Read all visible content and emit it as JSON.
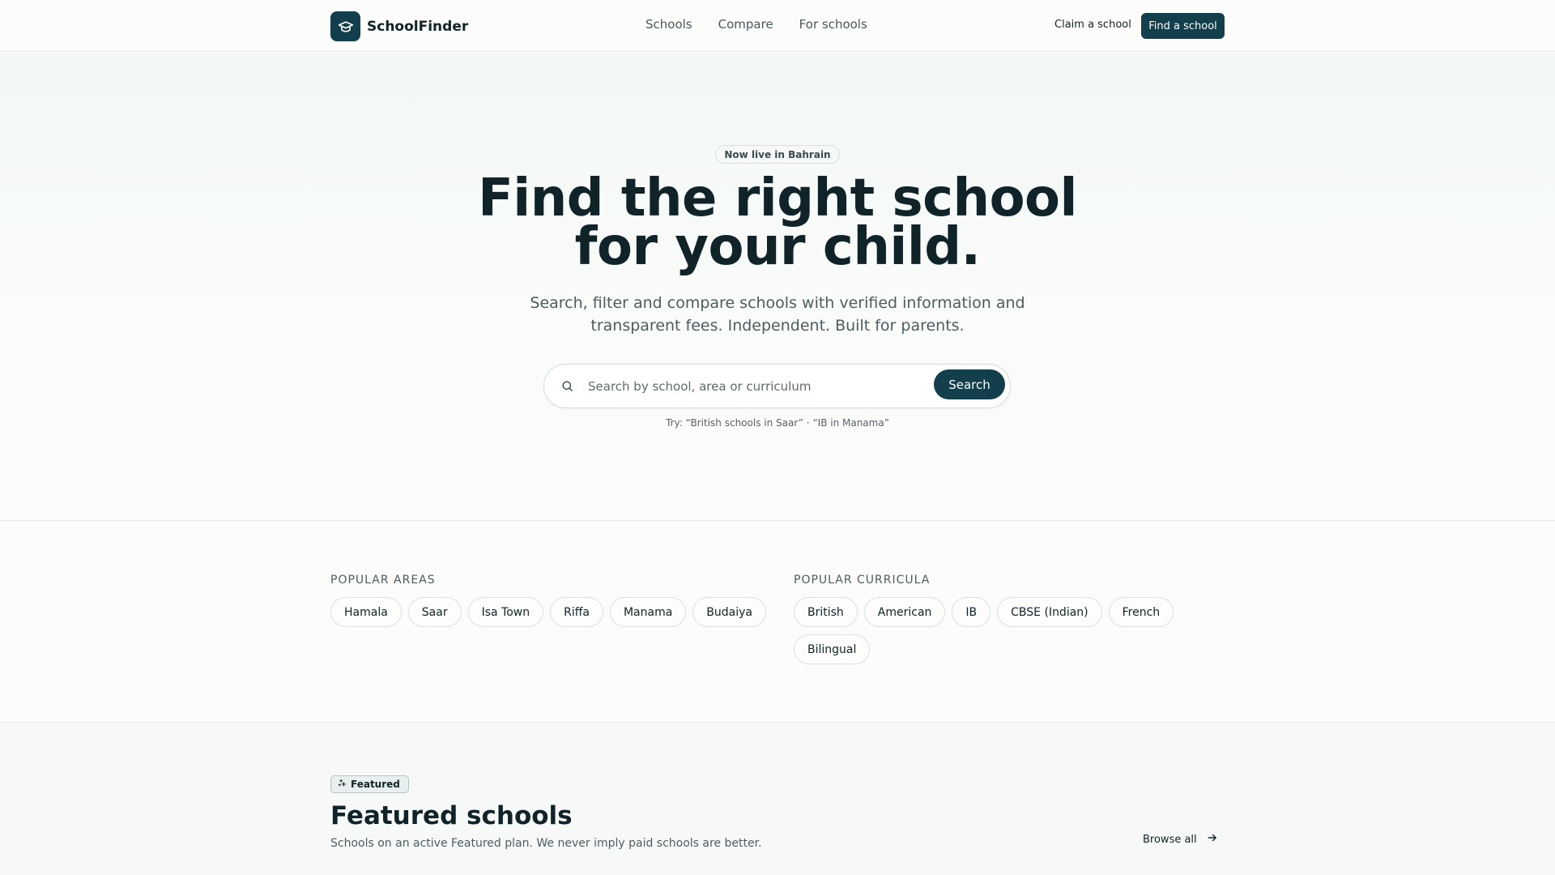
{
  "header": {
    "brand": "SchoolFinder",
    "nav": [
      "Schools",
      "Compare",
      "For schools"
    ],
    "claim_label": "Claim a school",
    "cta_label": "Find a school"
  },
  "hero": {
    "badge": "Now live in Bahrain",
    "headline_line1": "Find the right school",
    "headline_line2": "for your child.",
    "sub_line1": "Search, filter and compare schools with verified information and",
    "sub_line2": "transparent fees. Independent. Built for parents.",
    "search_placeholder": "Search by school, area or curriculum",
    "search_button": "Search",
    "try_text": "Try: “British schools in Saar” · “IB in Manama”"
  },
  "popular": {
    "areas_title": "POPULAR AREAS",
    "areas": [
      "Hamala",
      "Saar",
      "Isa Town",
      "Riffa",
      "Manama",
      "Budaiya"
    ],
    "curricula_title": "POPULAR CURRICULA",
    "curricula": [
      "British",
      "American",
      "IB",
      "CBSE (Indian)",
      "French",
      "Bilingual"
    ]
  },
  "featured": {
    "badge": "Featured",
    "title": "Featured schools",
    "subtitle": "Schools on an active Featured plan. We never imply paid schools are better.",
    "browse_label": "Browse all"
  },
  "colors": {
    "brand": "#123f4b",
    "text": "#0f2329",
    "muted": "#4d5c61",
    "background": "#fcfdfa"
  },
  "icons": [
    "graduation-cap-icon",
    "search-icon",
    "sparkle-icon",
    "arrow-right-icon"
  ]
}
